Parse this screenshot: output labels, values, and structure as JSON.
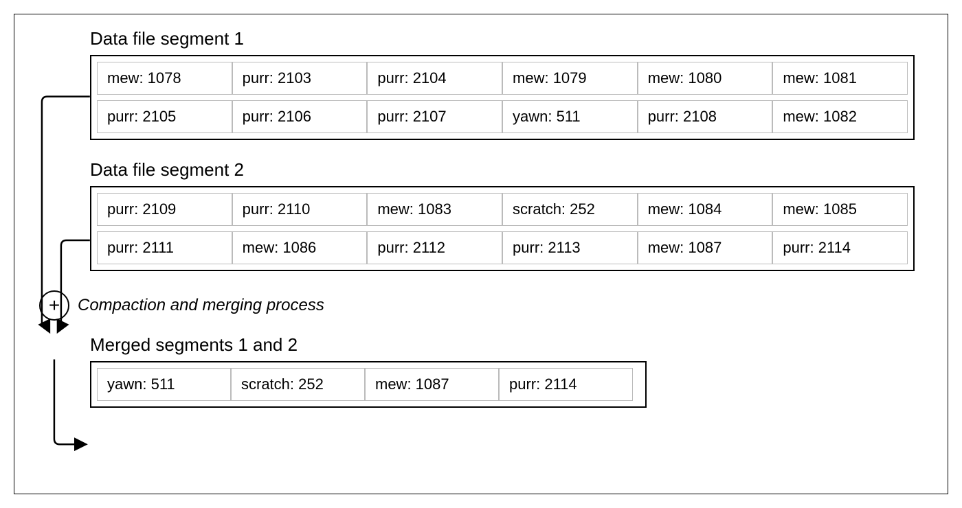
{
  "segment1": {
    "title": "Data file segment 1",
    "rows": [
      [
        "mew: 1078",
        "purr: 2103",
        "purr: 2104",
        "mew: 1079",
        "mew: 1080",
        "mew: 1081"
      ],
      [
        "purr: 2105",
        "purr: 2106",
        "purr: 2107",
        "yawn: 511",
        "purr: 2108",
        "mew: 1082"
      ]
    ]
  },
  "segment2": {
    "title": "Data file segment 2",
    "rows": [
      [
        "purr: 2109",
        "purr: 2110",
        "mew: 1083",
        "scratch: 252",
        "mew: 1084",
        "mew: 1085"
      ],
      [
        "purr: 2111",
        "mew: 1086",
        "purr: 2112",
        "purr: 2113",
        "mew: 1087",
        "purr: 2114"
      ]
    ]
  },
  "process": {
    "symbol": "+",
    "label": "Compaction and merging process"
  },
  "merged": {
    "title": "Merged segments 1 and 2",
    "rows": [
      [
        "yawn: 511",
        "scratch: 252",
        "mew: 1087",
        "purr: 2114"
      ]
    ]
  }
}
